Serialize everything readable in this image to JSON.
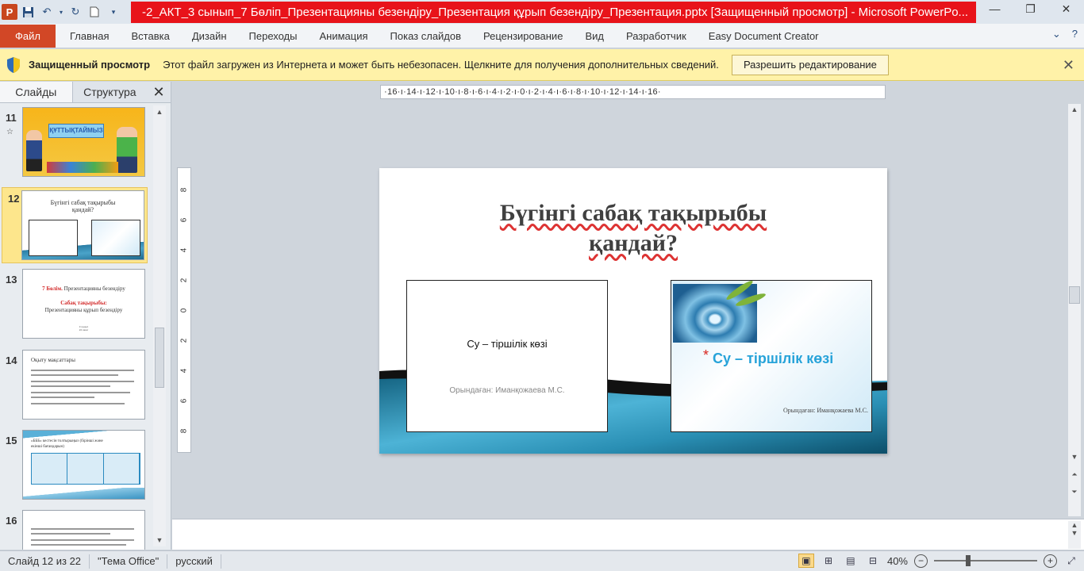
{
  "window": {
    "title": "-2_АКТ_3 сынып_7 Бөліп_Презентацияны безендіру_Презентация құрып безендіру_Презентация.pptx [Защищенный просмотр]  -  Microsoft PowerPo..."
  },
  "ribbon": {
    "file": "Файл",
    "tabs": [
      "Главная",
      "Вставка",
      "Дизайн",
      "Переходы",
      "Анимация",
      "Показ слайдов",
      "Рецензирование",
      "Вид",
      "Разработчик",
      "Easy Document Creator"
    ]
  },
  "protected_view": {
    "title": "Защищенный просмотр",
    "message": "Этот файл загружен из Интернета и может быть небезопасен. Щелкните для получения дополнительных сведений.",
    "button": "Разрешить редактирование"
  },
  "left_panel": {
    "tab_slides": "Слайды",
    "tab_outline": "Структура",
    "slides": [
      {
        "num": "11",
        "banner": "ҚҰТТЫҚТАЙМЫЗ"
      },
      {
        "num": "12",
        "title": "Бүгінгі сабақ тақырыбы қандай?"
      },
      {
        "num": "13",
        "line1_red": "7 Бөлім.",
        "line1": " Презентацияны безендіру",
        "line2": "Сабақ тақырыбы:",
        "line3": "Презентацияны құрып безендіру",
        "line4": "3 сынып",
        "line5": "22 сағат"
      },
      {
        "num": "14",
        "heading": "Оқыту мақсаттары"
      },
      {
        "num": "15",
        "heading": "«БББ» кестесін толтырыңыз (бірінші және екінші бағандарын)"
      },
      {
        "num": "16"
      }
    ]
  },
  "ruler": {
    "horizontal": "·16·ı·14·ı·12·ı·10·ı·8·ı·6·ı·4·ı·2·ı·0·ı·2·ı·4·ı·6·ı·8·ı·10·ı·12·ı·14·ı·16·",
    "vertical": [
      "8",
      "6",
      "4",
      "2",
      "0",
      "2",
      "4",
      "6",
      "8"
    ]
  },
  "slide": {
    "title_line1": "Бүгінгі сабақ тақырыбы",
    "title_line2": "қандай?",
    "embed1": {
      "title": "Су – тіршілік көзі",
      "author": "Орындаған: Иманқожаева М.С."
    },
    "embed2": {
      "star": "*",
      "title": "Су – тіршілік көзі",
      "author": "Орындаған: Иманқожаева М.С."
    }
  },
  "status": {
    "slide_info": "Слайд 12 из 22",
    "theme": "\"Тема Office\"",
    "language": "русский",
    "zoom": "40%"
  },
  "colors": {
    "title_bar_red": "#e8131a",
    "file_tab": "#d24726",
    "protected_bar": "#fff2a8",
    "selected_slide": "#fde68c"
  }
}
